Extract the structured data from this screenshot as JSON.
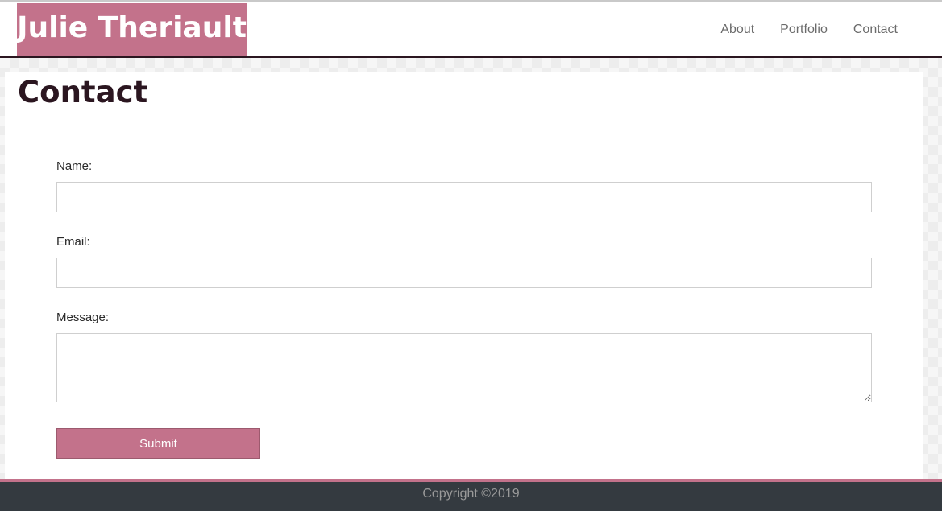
{
  "header": {
    "brand": "Julie Theriault",
    "nav": [
      {
        "label": "About"
      },
      {
        "label": "Portfolio"
      },
      {
        "label": "Contact"
      }
    ]
  },
  "page": {
    "title": "Contact"
  },
  "form": {
    "name": {
      "label": "Name:",
      "value": "",
      "placeholder": ""
    },
    "email": {
      "label": "Email:",
      "value": "",
      "placeholder": ""
    },
    "message": {
      "label": "Message:",
      "value": "",
      "placeholder": ""
    },
    "submit_label": "Submit"
  },
  "footer": {
    "copyright": "Copyright ©2019"
  },
  "colors": {
    "brand": "#c3728b",
    "title": "#2b1620",
    "footer_bg": "#343a40"
  }
}
